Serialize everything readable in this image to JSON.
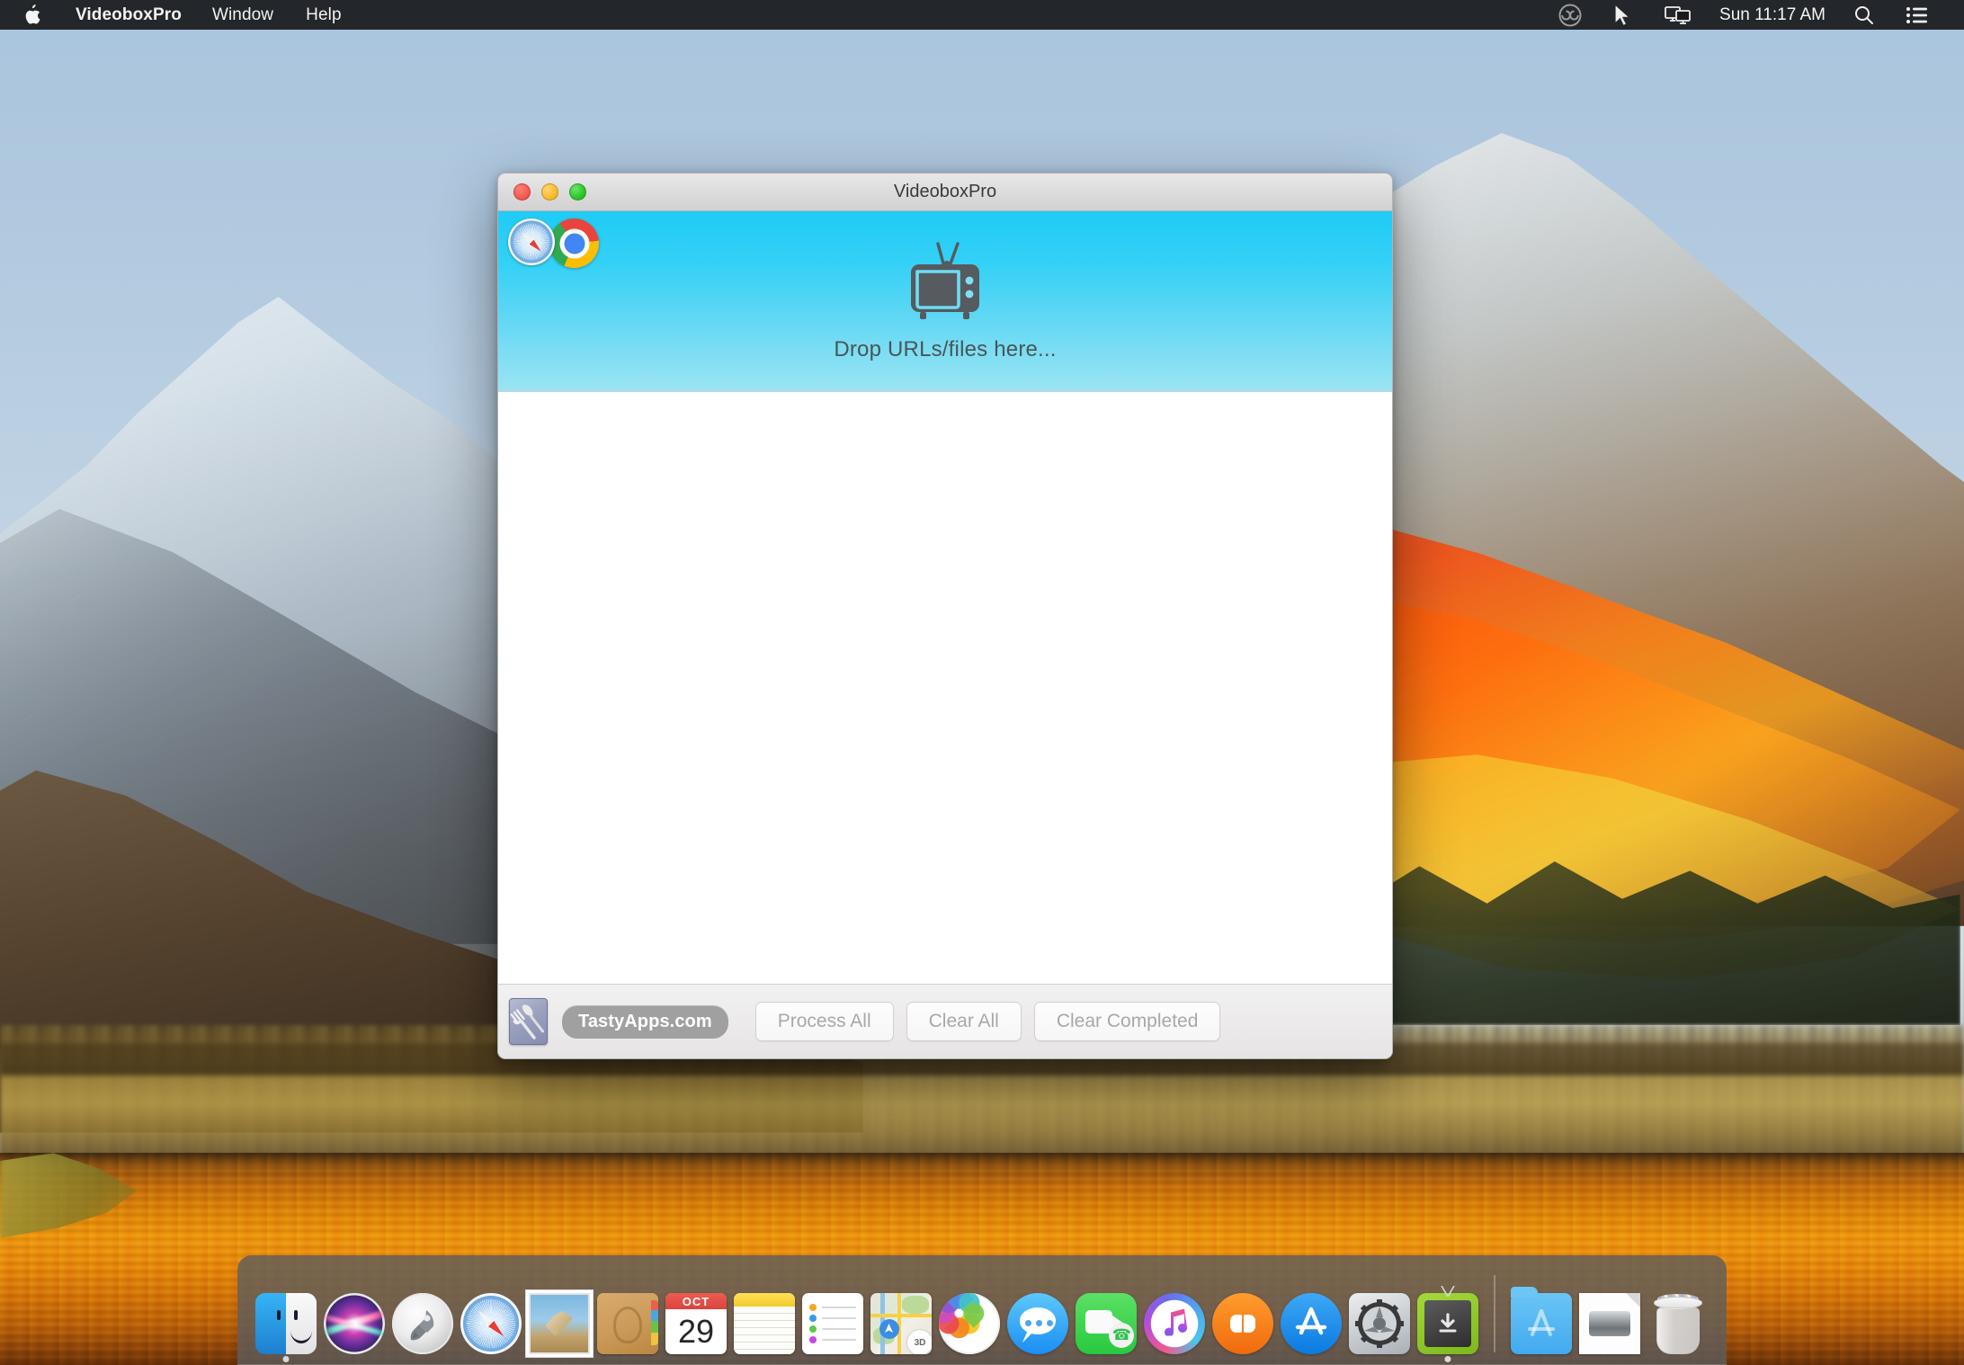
{
  "menubar": {
    "apple_icon": "apple-logo",
    "items": [
      {
        "label": "VideoboxPro",
        "bold": true
      },
      {
        "label": "Window",
        "bold": false
      },
      {
        "label": "Help",
        "bold": false
      }
    ],
    "status_icons": [
      {
        "name": "creative-cloud-icon"
      },
      {
        "name": "cursor-pointer-icon"
      },
      {
        "name": "screen-sharing-icon"
      }
    ],
    "clock": "Sun 11:17 AM",
    "search_icon": "search-icon",
    "control-center_icon": "control-center-icon"
  },
  "window": {
    "title": "VideoboxPro",
    "traffic_lights": [
      {
        "name": "close-button",
        "color": "#f85a52"
      },
      {
        "name": "minimize-button",
        "color": "#f9bc2d"
      },
      {
        "name": "zoom-button",
        "color": "#2dc52d"
      }
    ],
    "dropzone": {
      "label": "Drop URLs/files here...",
      "tv_icon": "tv-icon",
      "gradient_top": "#1fcbf5",
      "gradient_bottom": "#9ce4f2",
      "browser_icons": [
        {
          "name": "safari-icon"
        },
        {
          "name": "chrome-icon"
        }
      ]
    },
    "list": {
      "items": [],
      "empty": true
    },
    "bottombar": {
      "app_icon": "tastyapps-fork-knife-icon",
      "brand_pill": "TastyApps.com",
      "brand_pill_color": "#a0a0a0",
      "buttons": [
        {
          "label": "Process All",
          "enabled": false
        },
        {
          "label": "Clear All",
          "enabled": false
        },
        {
          "label": "Clear Completed",
          "enabled": false
        }
      ]
    }
  },
  "dock": {
    "items": [
      {
        "name": "finder",
        "label": "Finder",
        "running": true
      },
      {
        "name": "siri",
        "label": "Siri",
        "running": false
      },
      {
        "name": "launchpad",
        "label": "Launchpad",
        "running": false
      },
      {
        "name": "safari",
        "label": "Safari",
        "running": false
      },
      {
        "name": "mail",
        "label": "Mail",
        "running": false
      },
      {
        "name": "contacts",
        "label": "Contacts",
        "running": false
      },
      {
        "name": "calendar",
        "label": "Calendar",
        "running": false,
        "month": "OCT",
        "day": "29"
      },
      {
        "name": "notes",
        "label": "Notes",
        "running": false
      },
      {
        "name": "reminders",
        "label": "Reminders",
        "running": false
      },
      {
        "name": "maps",
        "label": "Maps",
        "running": false,
        "badge": "3D"
      },
      {
        "name": "photos",
        "label": "Photos",
        "running": false
      },
      {
        "name": "messages",
        "label": "Messages",
        "running": false
      },
      {
        "name": "facetime",
        "label": "FaceTime",
        "running": false
      },
      {
        "name": "itunes",
        "label": "iTunes",
        "running": false
      },
      {
        "name": "ibooks",
        "label": "iBooks",
        "running": false
      },
      {
        "name": "app-store",
        "label": "App Store",
        "running": false
      },
      {
        "name": "system-preferences",
        "label": "System Preferences",
        "running": false
      },
      {
        "name": "videoboxpro",
        "label": "VideoboxPro",
        "running": true
      }
    ],
    "right_items": [
      {
        "name": "applications-folder",
        "label": "Applications"
      },
      {
        "name": "disk-document",
        "label": "Document"
      },
      {
        "name": "trash",
        "label": "Trash"
      }
    ]
  }
}
